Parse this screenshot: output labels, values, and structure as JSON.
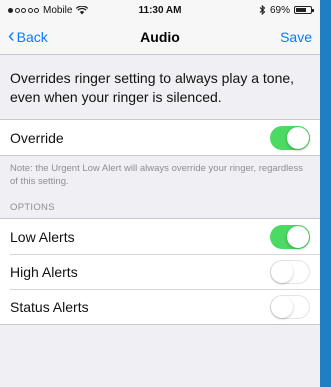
{
  "statusbar": {
    "carrier": "Mobile",
    "wifi_icon": "wifi-icon",
    "time": "11:30 AM",
    "bluetooth_icon": "bluetooth-icon",
    "battery_percent": "69%",
    "battery_level": 0.69
  },
  "navbar": {
    "back_label": "Back",
    "title": "Audio",
    "save_label": "Save"
  },
  "description": "Overrides ringer setting to always play a tone, even when your ringer is silenced.",
  "override": {
    "label": "Override",
    "on": true
  },
  "note": "Note: the Urgent Low Alert will always override your ringer, regardless of this setting.",
  "options": {
    "header": "OPTIONS",
    "items": [
      {
        "label": "Low Alerts",
        "on": true
      },
      {
        "label": "High Alerts",
        "on": false
      },
      {
        "label": "Status Alerts",
        "on": false
      }
    ]
  },
  "colors": {
    "accent": "#0a7aff",
    "toggle_on": "#4cd964",
    "background": "#efeff4",
    "frame": "#1f7fc4"
  }
}
